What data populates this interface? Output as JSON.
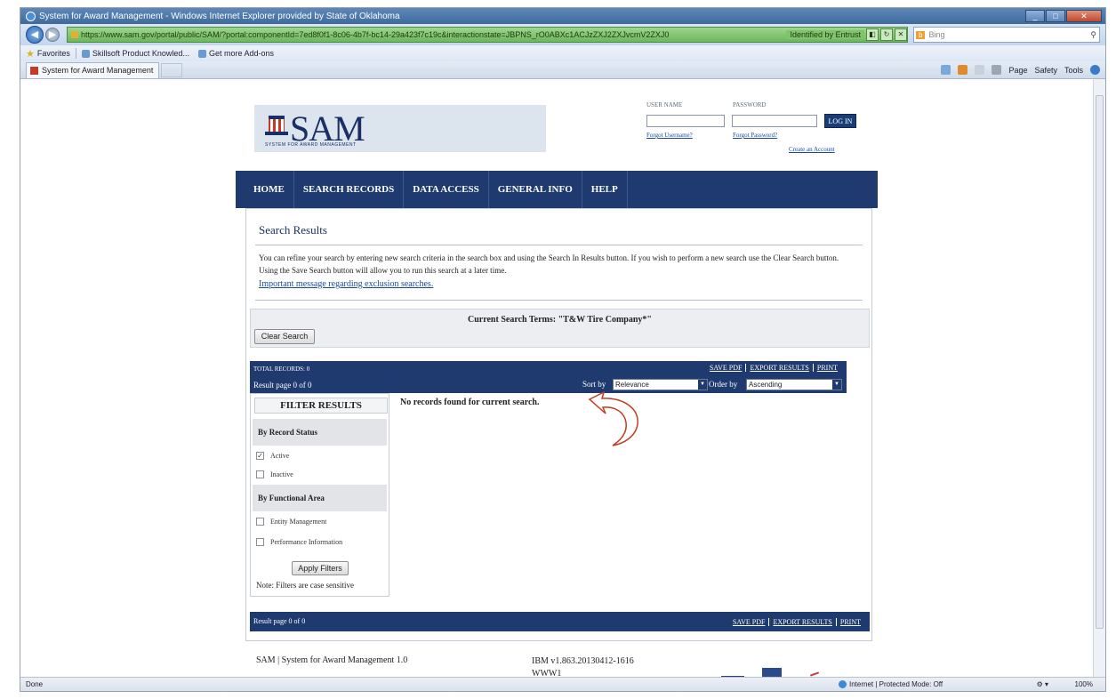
{
  "browser": {
    "window_title": "System for Award Management - Windows Internet Explorer provided by State of Oklahoma",
    "address": "https://www.sam.gov/portal/public/SAM/?portal:componentId=7ed8f0f1-8c06-4b7f-bc14-29a423f7c19c&interactionstate=JBPNS_rO0ABXc1ACJzZXJ2ZXJvcmV2ZXJ0",
    "verified_label": "Identified by Entrust",
    "search_provider": "Bing",
    "favorites_label": "Favorites",
    "favorites": [
      "Skillsoft Product Knowled...",
      "Get more Add-ons"
    ],
    "tab_title": "System for Award Management",
    "cmd_items": [
      "Page",
      "Safety",
      "Tools"
    ],
    "status_left": "Done",
    "status_zone": "Internet | Protected Mode: Off",
    "zoom": "100%"
  },
  "header": {
    "logo_text": "SAM",
    "logo_sub": "SYSTEM FOR AWARD MANAGEMENT",
    "username_label": "USER NAME",
    "password_label": "PASSWORD",
    "login_button": "LOG IN",
    "forgot_username": "Forgot Username?",
    "forgot_password": "Forgot Password?",
    "create_account": "Create an Account"
  },
  "nav": {
    "items": [
      "HOME",
      "SEARCH RECORDS",
      "DATA ACCESS",
      "GENERAL INFO",
      "HELP"
    ]
  },
  "results": {
    "heading": "Search Results",
    "intro": "You can refine your search by entering new search criteria in the search box and using the Search In Results button. If you wish to perform a new search use the Clear Search button. Using the Save Search button will allow you to run this search at a later time.",
    "intro_link": "Important message regarding exclusion searches.",
    "current_terms": "Current Search Terms: \"T&W Tire Company*\"",
    "clear_button": "Clear Search",
    "total_records": "TOTAL RECORDS: 0",
    "page_info": "Result page 0 of 0",
    "save_pdf": "SAVE PDF",
    "export": "EXPORT RESULTS",
    "print": "PRINT",
    "sort_label": "Sort by",
    "sort_value": "Relevance",
    "order_label": "Order by",
    "order_value": "Ascending",
    "no_records": "No records found for current search."
  },
  "filters": {
    "title": "FILTER RESULTS",
    "record_status_heading": "By Record Status",
    "active_label": "Active",
    "active_checked": true,
    "inactive_label": "Inactive",
    "functional_heading": "By Functional Area",
    "entity_label": "Entity Management",
    "performance_label": "Performance Information",
    "apply_button": "Apply Filters",
    "note": "Note: Filters are case sensitive"
  },
  "footer": {
    "left": "SAM | System for Award Management 1.0",
    "version": "IBM v1.863.20130412-1616",
    "server": "WWW1"
  }
}
